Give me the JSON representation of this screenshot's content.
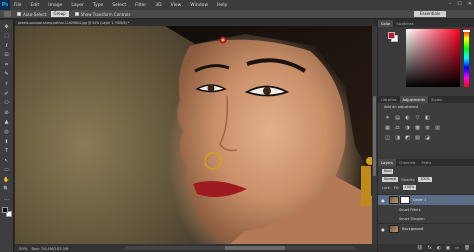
{
  "app": {
    "logo": "Ps",
    "menu": [
      "File",
      "Edit",
      "Image",
      "Layer",
      "Type",
      "Select",
      "Filter",
      "3D",
      "View",
      "Window",
      "Help"
    ],
    "window_controls": [
      "–",
      "☐",
      "✕"
    ]
  },
  "options_bar": {
    "auto_select_label": "Auto-Select:",
    "auto_select_value": "Group",
    "show_transform_label": "Show Transform Controls",
    "workspace": "Essentials"
  },
  "document": {
    "tab_label": "pexels-saunpar-sharp-pathar-11629804.jpg @ 50% (Layer 1, RGB/8) *",
    "zoom": "50%",
    "doc_size": "Doc: 34.4M/103.1M"
  },
  "color_panel": {
    "tabs": [
      "Color",
      "Swatches"
    ],
    "foreground": "#c8102e",
    "background": "#ffffff"
  },
  "adjustments_panel": {
    "tabs": [
      "Libraries",
      "Adjustments",
      "Styles"
    ],
    "heading": "Add an adjustment",
    "icons_row1": [
      "☀",
      "▤",
      "◐",
      "▽",
      "◧"
    ],
    "icons_row2": [
      "▦",
      "⚖",
      "◑",
      "▩",
      "◍",
      "▥"
    ],
    "icons_row3": [
      "◫",
      "◨",
      "◩",
      "▧",
      "◪"
    ]
  },
  "layers_panel": {
    "tabs": [
      "Layers",
      "Channels",
      "Paths"
    ],
    "kind_label": "Kind",
    "blend_mode": "Normal",
    "opacity_label": "Opacity:",
    "opacity_value": "100%",
    "lock_label": "Lock:",
    "fill_label": "Fill:",
    "fill_value": "100%",
    "layers": [
      {
        "name": "Layer 1",
        "selected": true,
        "has_mask": true
      },
      {
        "name": "Background",
        "selected": false,
        "has_mask": false
      }
    ],
    "sublayers": [
      "Smart Filters",
      "Smart Sharpen"
    ],
    "footer_icons": [
      "⛓",
      "fx",
      "◐",
      "▣",
      "▭",
      "🗑"
    ]
  },
  "tools": [
    "✥",
    "⬚",
    "ℓ",
    "⊡",
    "⌗",
    "✎",
    "⚕",
    "✐",
    "⎔",
    "⊘",
    "▲",
    "◎",
    "⬆",
    "T",
    "↖",
    "▭",
    "✋",
    "🔍",
    "…"
  ]
}
